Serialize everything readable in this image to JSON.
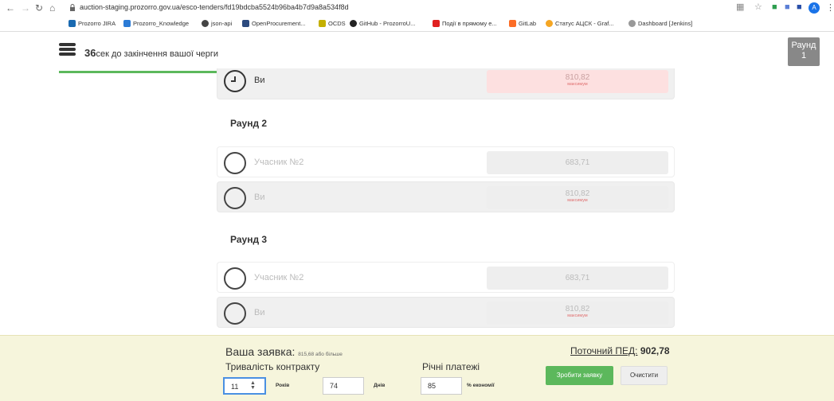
{
  "browser": {
    "url": "auction-staging.prozorro.gov.ua/esco-tenders/fd19bdcba5524b96ba4b7d9a8a534f8d",
    "bookmarks": [
      {
        "label": "Prozorro JIRA",
        "color": "#1a6ab1"
      },
      {
        "label": "Prozorro_Knowledge",
        "color": "#2b7bd6"
      },
      {
        "label": "json-api",
        "color": "#444444"
      },
      {
        "label": "OpenProcurement...",
        "color": "#2c4a7e"
      },
      {
        "label": "OCDS",
        "color": "#c4b000"
      },
      {
        "label": "GitHub - ProzorroU...",
        "color": "#222222"
      },
      {
        "label": "Події в прямому е...",
        "color": "#e02020"
      },
      {
        "label": "GitLab",
        "color": "#fc6d26"
      },
      {
        "label": "Статус АЦСК - Graf...",
        "color": "#f5a623"
      },
      {
        "label": "Dashboard [Jenkins]",
        "color": "#999999"
      }
    ],
    "profile_initial": "A"
  },
  "header": {
    "timer_value": "36",
    "timer_text": "сек до закінчення вашої черги",
    "round_label": "Раунд",
    "round_number": "1",
    "progress_percent": 93
  },
  "rounds": {
    "round1_me": {
      "name": "Ви",
      "value": "810,82",
      "note": "максимум"
    },
    "round2": {
      "title": "Раунд 2",
      "participant": {
        "name": "Учасник №2",
        "value": "683,71"
      },
      "me": {
        "name": "Ви",
        "value": "810,82",
        "note": "максимум"
      }
    },
    "round3": {
      "title": "Раунд 3",
      "participant": {
        "name": "Учасник №2",
        "value": "683,71"
      },
      "me": {
        "name": "Ви",
        "value": "810,82",
        "note": "максимум"
      }
    }
  },
  "bid_panel": {
    "title": "Ваша заявка:",
    "subtitle": "815,68 або більше",
    "ped_label": "Поточний ПЕД:",
    "ped_value": "902,78",
    "duration_label": "Тривалість контракту",
    "years_value": "11",
    "years_unit": "Років",
    "days_value": "74",
    "days_unit": "Днів",
    "payments_label": "Річні платежі",
    "payments_value": "85",
    "payments_unit": "% економії",
    "submit_label": "Зробити заявку",
    "clear_label": "Очистити"
  }
}
